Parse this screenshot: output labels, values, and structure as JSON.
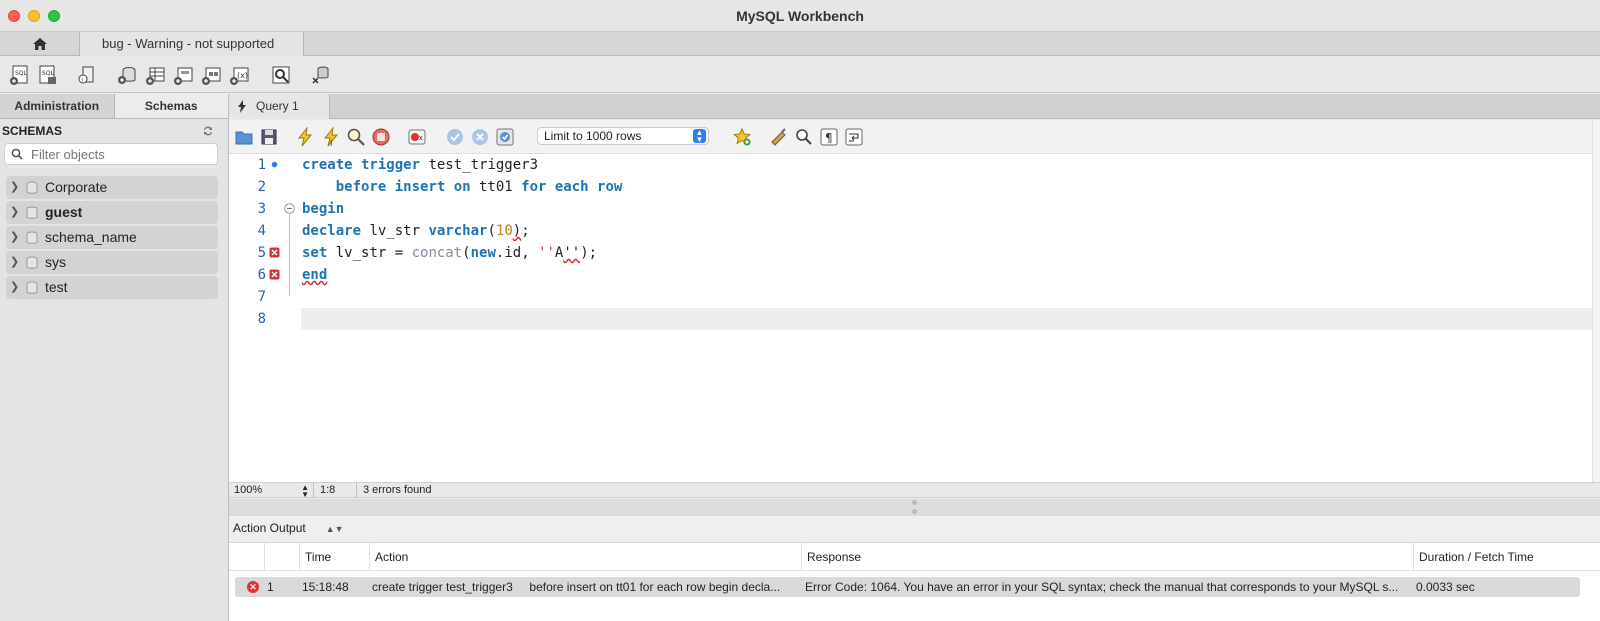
{
  "window": {
    "title": "MySQL Workbench"
  },
  "connection_tab": {
    "label": "bug - Warning - not supported"
  },
  "sidebar": {
    "tabs": [
      "Administration",
      "Schemas"
    ],
    "header": "SCHEMAS",
    "filter_placeholder": "Filter objects",
    "schemas": [
      {
        "name": "Corporate",
        "bold": false
      },
      {
        "name": "guest",
        "bold": true
      },
      {
        "name": "schema_name",
        "bold": false
      },
      {
        "name": "sys",
        "bold": false
      },
      {
        "name": "test",
        "bold": false
      }
    ]
  },
  "query_tab": {
    "label": "Query 1"
  },
  "editor_toolbar": {
    "limit_label": "Limit to 1000 rows"
  },
  "editor": {
    "line_numbers": [
      "1",
      "2",
      "3",
      "4",
      "5",
      "6",
      "7",
      "8"
    ]
  },
  "status": {
    "zoom": "100%",
    "position": "1:8",
    "errors": "3 errors found"
  },
  "output": {
    "selector": "Action Output",
    "columns": [
      "Time",
      "Action",
      "Response",
      "Duration / Fetch Time"
    ],
    "rows": [
      {
        "index": "1",
        "time": "15:18:48",
        "action": "create trigger test_trigger3     before insert on tt01 for each row begin decla...",
        "response": "Error Code: 1064. You have an error in your SQL syntax; check the manual that corresponds to your MySQL s...",
        "duration": "0.0033 sec"
      }
    ]
  },
  "colors": {
    "keyword": "#1e73b4",
    "line_number": "#2a62a6",
    "error": "#d33333"
  }
}
